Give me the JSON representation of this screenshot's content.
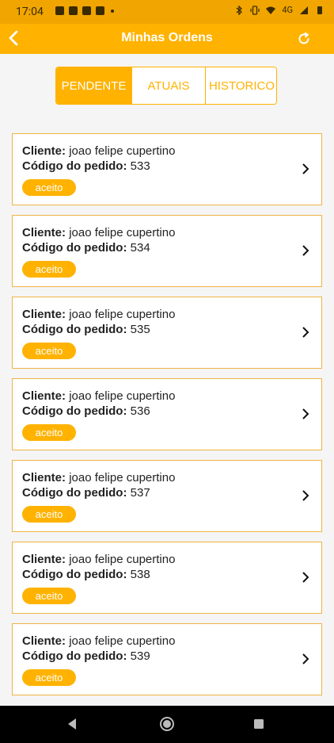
{
  "status_bar": {
    "time": "17:04",
    "notification_icons": [
      "message-icon",
      "news-icon",
      "sim-icon",
      "image-icon"
    ],
    "right_icons": [
      "bluetooth-icon",
      "vibrate-icon",
      "wifi-icon",
      "signal-icon",
      "battery-icon"
    ],
    "network_label": "4G"
  },
  "appbar": {
    "title": "Minhas Ordens"
  },
  "tabs": [
    {
      "label": "PENDENTE",
      "active": true
    },
    {
      "label": "ATUAIS",
      "active": false
    },
    {
      "label": "HISTORICO",
      "active": false
    }
  ],
  "orders": [
    {
      "client_label": "Cliente:",
      "client": "joao felipe cupertino",
      "code_label": "Código do pedido:",
      "code": "533",
      "status": "aceito"
    },
    {
      "client_label": "Cliente:",
      "client": "joao felipe cupertino",
      "code_label": "Código do pedido:",
      "code": "534",
      "status": "aceito"
    },
    {
      "client_label": "Cliente:",
      "client": "joao felipe cupertino",
      "code_label": "Código do pedido:",
      "code": "535",
      "status": "aceito"
    },
    {
      "client_label": "Cliente:",
      "client": "joao felipe cupertino",
      "code_label": "Código do pedido:",
      "code": "536",
      "status": "aceito"
    },
    {
      "client_label": "Cliente:",
      "client": "joao felipe cupertino",
      "code_label": "Código do pedido:",
      "code": "537",
      "status": "aceito"
    },
    {
      "client_label": "Cliente:",
      "client": "joao felipe cupertino",
      "code_label": "Código do pedido:",
      "code": "538",
      "status": "aceito"
    },
    {
      "client_label": "Cliente:",
      "client": "joao felipe cupertino",
      "code_label": "Código do pedido:",
      "code": "539",
      "status": "aceito"
    }
  ],
  "colors": {
    "accent": "#ffb200",
    "status_bar": "#f0a500",
    "card_border": "#f0b445",
    "background": "#f5f5f5",
    "nav_bar": "#000000"
  }
}
